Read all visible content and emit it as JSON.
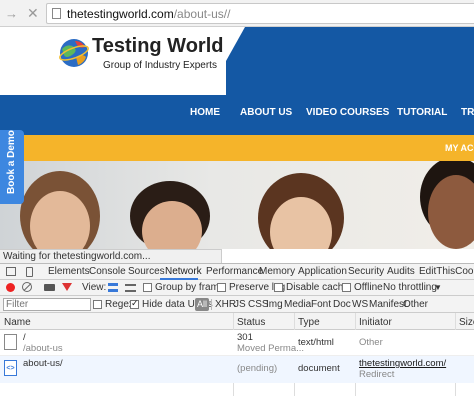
{
  "browser": {
    "url_host": "thetestingworld.com",
    "url_path": "/about-us//"
  },
  "site": {
    "brand": "Testing World",
    "tagline": "Group of Industry Experts",
    "nav": [
      "HOME",
      "ABOUT US",
      "VIDEO COURSES",
      "TUTORIAL",
      "TR"
    ],
    "account_link": "MY ACC",
    "demo_tab": "Book a Demo"
  },
  "status_text": "Waiting for thetestingworld.com...",
  "devtools": {
    "tabs": [
      "Elements",
      "Console",
      "Sources",
      "Network",
      "Performance",
      "Memory",
      "Application",
      "Security",
      "Audits",
      "EditThisCookie"
    ],
    "active_tab": "Network",
    "toolbar": {
      "view_label": "View:",
      "group_by_frame": "Group by frame",
      "preserve_log": "Preserve log",
      "disable_cache": "Disable cache",
      "offline": "Offline",
      "throttling": "No throttling"
    },
    "filter": {
      "placeholder": "Filter",
      "regex": "Regex",
      "hide_data_urls": "Hide data URLs",
      "types": [
        "All",
        "XHR",
        "JS",
        "CSS",
        "Img",
        "Media",
        "Font",
        "Doc",
        "WS",
        "Manifest",
        "Other"
      ]
    },
    "columns": [
      "Name",
      "Status",
      "Type",
      "Initiator",
      "Size"
    ],
    "rows": [
      {
        "name": "/",
        "path": "/about-us",
        "status": "301",
        "status_text": "Moved Perma...",
        "type": "text/html",
        "initiator": "Other",
        "initiator_sub": ""
      },
      {
        "name": "about-us/",
        "path": "",
        "status": "(pending)",
        "status_text": "",
        "type": "document",
        "initiator": "thetestingworld.com/",
        "initiator_sub": "Redirect"
      }
    ]
  }
}
